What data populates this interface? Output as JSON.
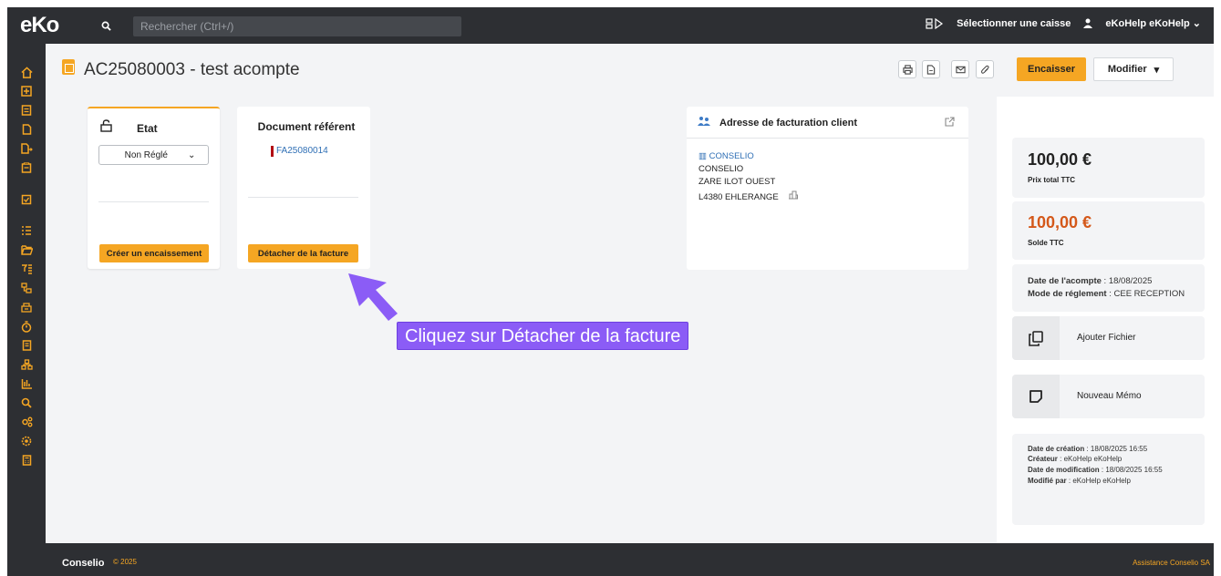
{
  "app": {
    "logo": "eKo"
  },
  "topbar": {
    "search_placeholder": "Rechercher (Ctrl+/)",
    "select_caisse": "Sélectionner une caisse",
    "user": "eKoHelp eKoHelp"
  },
  "header": {
    "title": "AC25080003 - test acompte",
    "encaisser": "Encaisser",
    "modifier": "Modifier"
  },
  "etat": {
    "title": "Etat",
    "status": "Non Réglé",
    "create_button": "Créer un encaissement"
  },
  "document_ref": {
    "title": "Document référent",
    "ref": "FA25080014",
    "detach_button": "Détacher de la facture"
  },
  "address": {
    "title": "Adresse de facturation client",
    "company_link": "CONSELIO",
    "name": "CONSELIO",
    "street": "ZARE ILOT OUEST",
    "city": "L4380 EHLERANGE"
  },
  "summary": {
    "total_value": "100,00 €",
    "total_label": "Prix total TTC",
    "solde_value": "100,00 €",
    "solde_label": "Solde TTC",
    "date_acompte_label": "Date de l'acompte",
    "date_acompte": "18/08/2025",
    "mode_label": "Mode de réglement",
    "mode": "CEE RECEPTION",
    "add_file": "Ajouter Fichier",
    "new_memo": "Nouveau Mémo",
    "created_label": "Date de création",
    "created": "18/08/2025 16:55",
    "creator_label": "Créateur",
    "creator": "eKoHelp eKoHelp",
    "modified_label": "Date de modification",
    "modified": "18/08/2025 16:55",
    "modified_by_label": "Modifié par",
    "modified_by": "eKoHelp eKoHelp"
  },
  "annotation": {
    "callout": "Cliquez sur Détacher de la facture"
  },
  "footer": {
    "brand": "Conselio",
    "year": "© 2025",
    "help": "Assistance Conselio SA"
  },
  "colors": {
    "accent": "#f5a623",
    "dark": "#2d2f33",
    "callout": "#8b5cf6",
    "solde": "#d4581a",
    "link": "#2f6fb5"
  }
}
